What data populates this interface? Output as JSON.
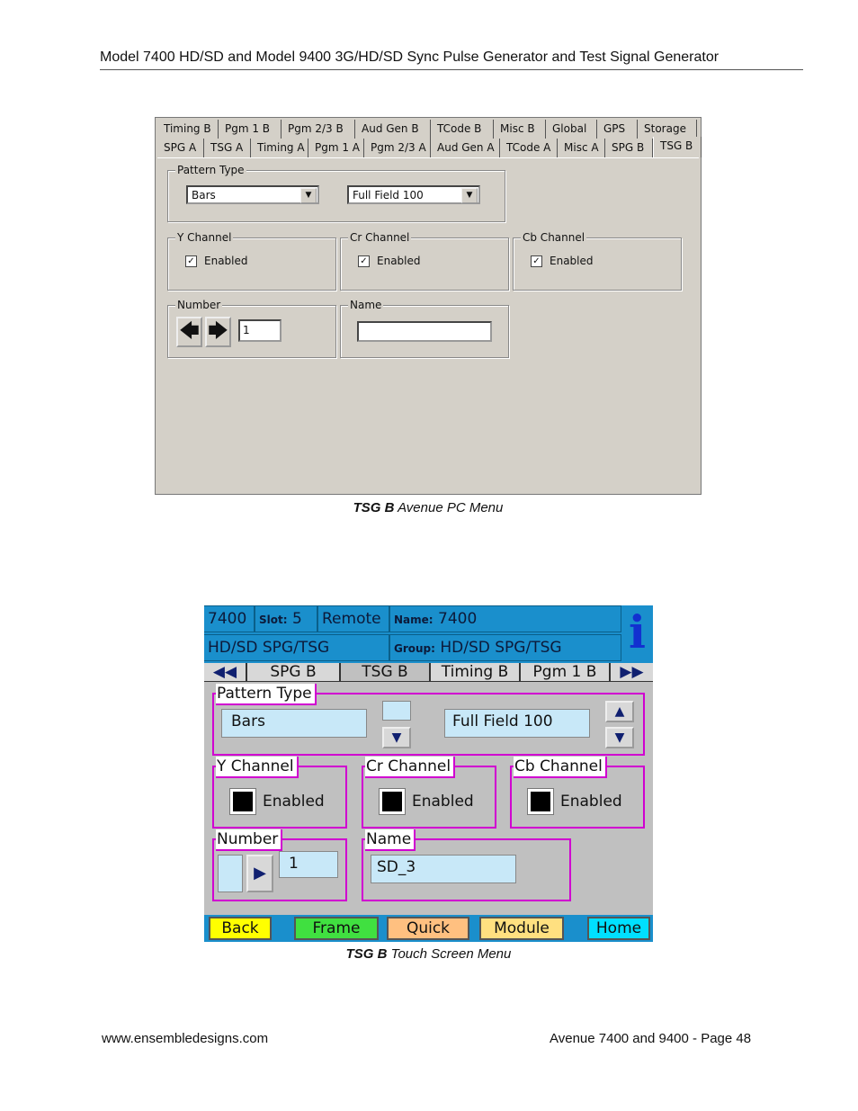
{
  "header": {
    "title": "Model 7400 HD/SD and Model 9400 3G/HD/SD Sync Pulse Generator and Test Signal Generator"
  },
  "pc_menu": {
    "tabs_row1": [
      "Timing B",
      "Pgm 1 B",
      "Pgm 2/3 B",
      "Aud Gen B",
      "TCode B",
      "Misc B",
      "Global",
      "GPS",
      "Storage"
    ],
    "tabs_row2": [
      "SPG A",
      "TSG A",
      "Timing A",
      "Pgm 1 A",
      "Pgm 2/3 A",
      "Aud Gen A",
      "TCode A",
      "Misc A",
      "SPG B",
      "TSG B"
    ],
    "pattern_type_label": "Pattern Type",
    "pattern_value": "Bars",
    "pattern_sub_value": "Full Field 100",
    "y_channel_label": "Y Channel",
    "cr_channel_label": "Cr Channel",
    "cb_channel_label": "Cb Channel",
    "enabled_label": "Enabled",
    "number_label": "Number",
    "number_value": "1",
    "name_label": "Name",
    "name_value": ""
  },
  "caption1": {
    "bold": "TSG B",
    "rest": " Avenue PC Menu"
  },
  "touch_menu": {
    "model": "7400",
    "slot_label": "Slot:",
    "slot_value": "5",
    "mode": "Remote",
    "name_label": "Name:",
    "name_value": "7400",
    "module_type": "HD/SD SPG/TSG",
    "group_label": "Group:",
    "group_value": "HD/SD SPG/TSG",
    "tabs": [
      "SPG B",
      "TSG B",
      "Timing B",
      "Pgm 1 B"
    ],
    "pattern_type_label": "Pattern Type",
    "pattern_value": "Bars",
    "pattern_sub_value": "Full Field 100",
    "y_channel_label": "Y Channel",
    "cr_channel_label": "Cr Channel",
    "cb_channel_label": "Cb Channel",
    "enabled_label": "Enabled",
    "number_label": "Number",
    "number_value": "1",
    "name_field_label": "Name",
    "name_field_value": "SD_3",
    "nav": [
      "Back",
      "Frame",
      "Quick",
      "Module",
      "Home"
    ],
    "colors": {
      "header_blue": "#1a8fcc",
      "group_border": "#d000d0",
      "back": "#ffff00",
      "frame": "#40e040",
      "quick": "#ffc080",
      "module": "#ffe080",
      "home": "#00e0ff"
    }
  },
  "caption2": {
    "bold": "TSG B",
    "rest": " Touch Screen Menu"
  },
  "footer": {
    "left": "www.ensembledesigns.com",
    "right": "Avenue 7400 and 9400 - Page 48"
  }
}
